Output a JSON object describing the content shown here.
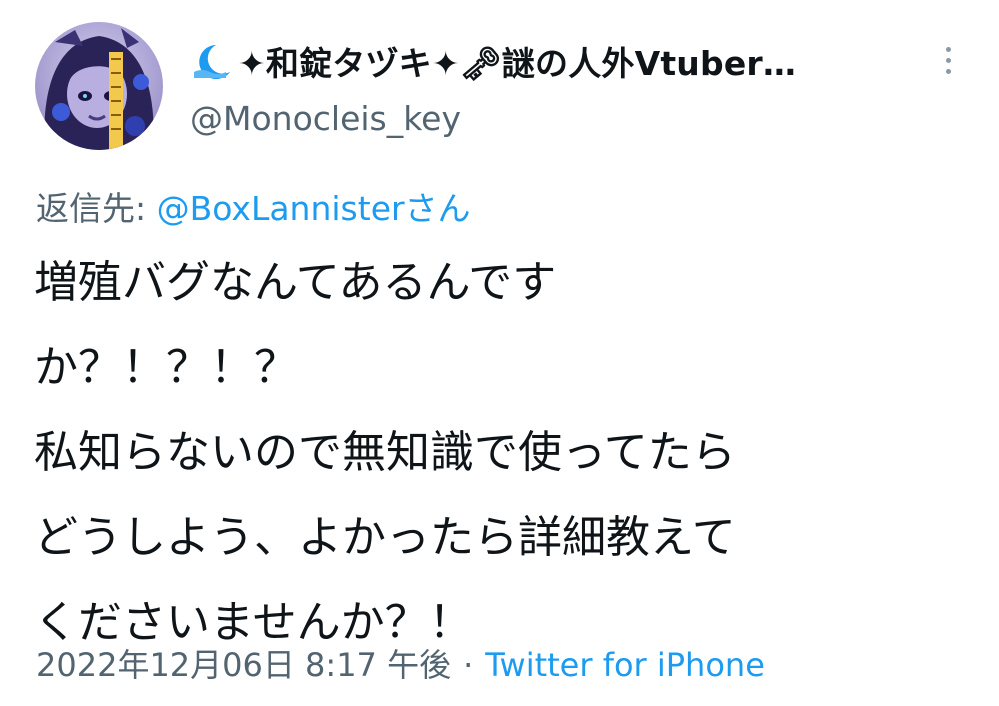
{
  "author": {
    "display_name": "✦和錠タヅキ✦🗝謎の人外Vtuber…",
    "handle": "@Monocleis_key",
    "avatar_icon": "avatar-illustration",
    "badge_icon": "crescent-moon-icon"
  },
  "reply": {
    "prefix": "返信先: ",
    "target": "@BoxLannisterさん"
  },
  "body_lines": [
    "増殖バグなんてあるんです",
    "か？！？！？",
    "私知らないので無知識で使ってたら",
    "どうしよう、よかったら詳細教えて",
    "くださいませんか？！"
  ],
  "meta": {
    "timestamp": "2022年12月06日 8:17 午後",
    "separator": "·",
    "source": "Twitter for iPhone"
  },
  "colors": {
    "text": "#0f1419",
    "secondary": "#536471",
    "link": "#1d9bf0"
  }
}
